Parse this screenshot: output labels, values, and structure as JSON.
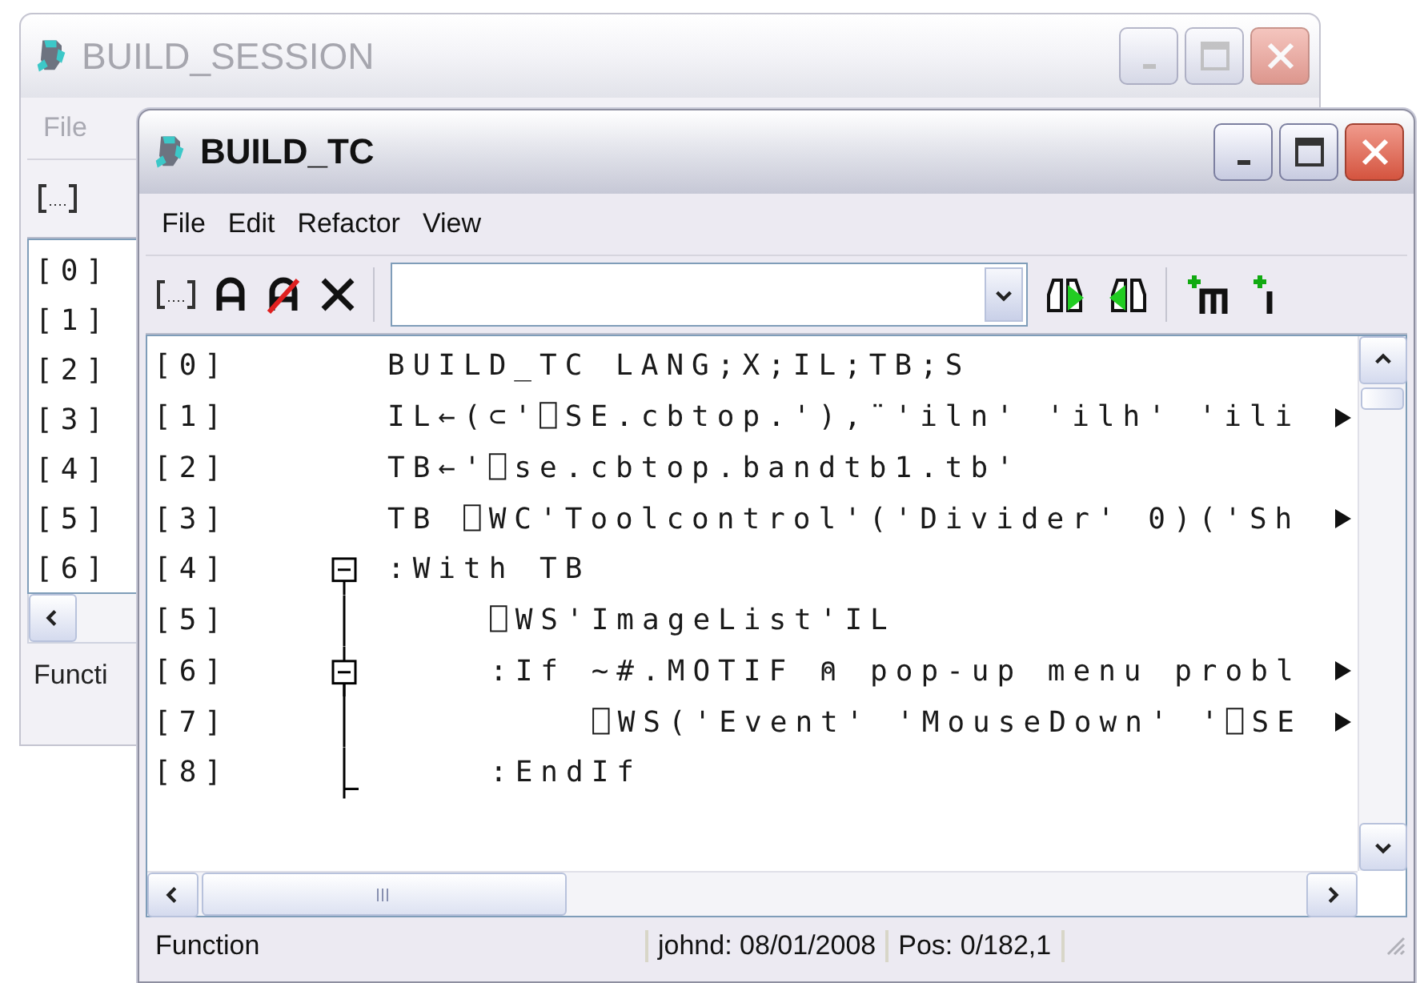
{
  "background_window": {
    "title": "BUILD_SESSION",
    "active": false,
    "menu": [
      "File"
    ],
    "line_numbers": [
      "[0]",
      "[1]",
      "[2]",
      "[3]",
      "[4]",
      "[5]",
      "[6]"
    ],
    "status": "Functi"
  },
  "window": {
    "title": "BUILD_TC",
    "active": true,
    "menu": [
      "File",
      "Edit",
      "Refactor",
      "View"
    ]
  },
  "editor": {
    "rows": [
      {
        "number": "[0]",
        "code": "BUILD_TC LANG;X;IL;TB;S",
        "truncated": false
      },
      {
        "number": "[1]",
        "code": "IL←(⊂'⎕SE.cbtop.'),¨'iln' 'ilh' 'ili",
        "truncated": true
      },
      {
        "number": "[2]",
        "code": "TB←'⎕se.cbtop.bandtb1.tb'",
        "truncated": false
      },
      {
        "number": "[3]",
        "code": "TB ⎕WC'Toolcontrol'('Divider' 0)('Sh",
        "truncated": true
      },
      {
        "number": "[4]",
        "code": ":With TB",
        "truncated": false,
        "expanded": true,
        "children": [
          {
            "number": "[5]",
            "code": "⎕WS'ImageList'IL",
            "truncated": false
          },
          {
            "number": "[6]",
            "code": ":If ~#.MOTIF ⍝ pop-up menu probl",
            "truncated": true,
            "expanded": true,
            "children": [
              {
                "number": "[7]",
                "code": "⎕WS('Event' 'MouseDown' '⎕SE",
                "truncated": true
              }
            ]
          },
          {
            "number": "[8]",
            "code": ":EndIf",
            "truncated": false,
            "block_end": true
          }
        ]
      }
    ]
  },
  "status_bar": [
    "Function",
    "johnd: 08/01/2008",
    "Pos: 0/182,1"
  ]
}
